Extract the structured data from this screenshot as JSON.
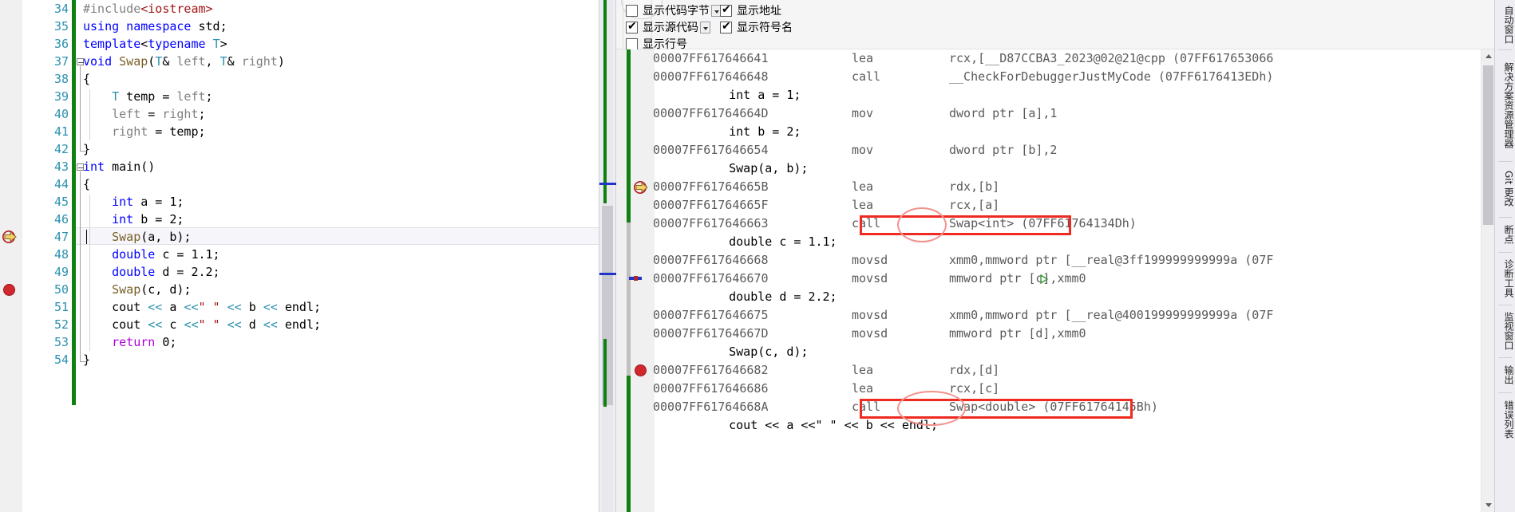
{
  "editor": {
    "first_line": 34,
    "lines": [
      {
        "n": 34,
        "tokens": [
          {
            "t": "#include",
            "c": "pp"
          },
          {
            "t": "<iostream>",
            "c": "str"
          }
        ]
      },
      {
        "n": 35,
        "tokens": [
          {
            "t": "using namespace ",
            "c": "k"
          },
          {
            "t": "std;",
            "c": "pl"
          }
        ]
      },
      {
        "n": 36,
        "tokens": [
          {
            "t": "template",
            "c": "k"
          },
          {
            "t": "<",
            "c": "pl"
          },
          {
            "t": "typename",
            "c": "k"
          },
          {
            "t": " ",
            "c": "pl"
          },
          {
            "t": "T",
            "c": "ty"
          },
          {
            "t": ">",
            "c": "pl"
          }
        ]
      },
      {
        "n": 37,
        "tokens": [
          {
            "t": "void",
            "c": "k"
          },
          {
            "t": " ",
            "c": "pl"
          },
          {
            "t": "Swap",
            "c": "fn"
          },
          {
            "t": "(",
            "c": "pl"
          },
          {
            "t": "T",
            "c": "ty"
          },
          {
            "t": "& ",
            "c": "pl"
          },
          {
            "t": "left",
            "c": "id"
          },
          {
            "t": ", ",
            "c": "pl"
          },
          {
            "t": "T",
            "c": "ty"
          },
          {
            "t": "& ",
            "c": "pl"
          },
          {
            "t": "right",
            "c": "id"
          },
          {
            "t": ")",
            "c": "pl"
          }
        ]
      },
      {
        "n": 38,
        "tokens": [
          {
            "t": "{",
            "c": "pl"
          }
        ]
      },
      {
        "n": 39,
        "tokens": [
          {
            "t": "    ",
            "c": "pl"
          },
          {
            "t": "T",
            "c": "ty"
          },
          {
            "t": " temp = ",
            "c": "pl"
          },
          {
            "t": "left",
            "c": "id"
          },
          {
            "t": ";",
            "c": "pl"
          }
        ]
      },
      {
        "n": 40,
        "tokens": [
          {
            "t": "    ",
            "c": "pl"
          },
          {
            "t": "left",
            "c": "id"
          },
          {
            "t": " = ",
            "c": "pl"
          },
          {
            "t": "right",
            "c": "id"
          },
          {
            "t": ";",
            "c": "pl"
          }
        ]
      },
      {
        "n": 41,
        "tokens": [
          {
            "t": "    ",
            "c": "pl"
          },
          {
            "t": "right",
            "c": "id"
          },
          {
            "t": " = ",
            "c": "pl"
          },
          {
            "t": "temp",
            "c": "pl"
          },
          {
            "t": ";",
            "c": "pl"
          }
        ]
      },
      {
        "n": 42,
        "tokens": [
          {
            "t": "}",
            "c": "pl"
          }
        ]
      },
      {
        "n": 43,
        "tokens": [
          {
            "t": "int",
            "c": "k"
          },
          {
            "t": " ",
            "c": "pl"
          },
          {
            "t": "main",
            "c": "pl"
          },
          {
            "t": "()",
            "c": "pl"
          }
        ]
      },
      {
        "n": 44,
        "tokens": [
          {
            "t": "{",
            "c": "pl"
          }
        ]
      },
      {
        "n": 45,
        "tokens": [
          {
            "t": "    ",
            "c": "pl"
          },
          {
            "t": "int",
            "c": "k"
          },
          {
            "t": " a = 1;",
            "c": "pl"
          }
        ]
      },
      {
        "n": 46,
        "tokens": [
          {
            "t": "    ",
            "c": "pl"
          },
          {
            "t": "int",
            "c": "k"
          },
          {
            "t": " b = 2;",
            "c": "pl"
          }
        ]
      },
      {
        "n": 47,
        "tokens": [
          {
            "t": "    ",
            "c": "pl"
          },
          {
            "t": "Swap",
            "c": "fn"
          },
          {
            "t": "(a, b);",
            "c": "pl"
          }
        ]
      },
      {
        "n": 48,
        "tokens": [
          {
            "t": "    ",
            "c": "pl"
          },
          {
            "t": "double",
            "c": "k"
          },
          {
            "t": " c = 1.1;",
            "c": "pl"
          }
        ]
      },
      {
        "n": 49,
        "tokens": [
          {
            "t": "    ",
            "c": "pl"
          },
          {
            "t": "double",
            "c": "k"
          },
          {
            "t": " d = 2.2;",
            "c": "pl"
          }
        ]
      },
      {
        "n": 50,
        "tokens": [
          {
            "t": "    ",
            "c": "pl"
          },
          {
            "t": "Swap",
            "c": "fn"
          },
          {
            "t": "(c, d);",
            "c": "pl"
          }
        ]
      },
      {
        "n": 51,
        "tokens": [
          {
            "t": "    cout ",
            "c": "pl"
          },
          {
            "t": "<<",
            "c": "ty"
          },
          {
            "t": " a ",
            "c": "pl"
          },
          {
            "t": "<<",
            "c": "ty"
          },
          {
            "t": "\" \"",
            "c": "str"
          },
          {
            "t": " ",
            "c": "pl"
          },
          {
            "t": "<<",
            "c": "ty"
          },
          {
            "t": " b ",
            "c": "pl"
          },
          {
            "t": "<<",
            "c": "ty"
          },
          {
            "t": " endl;",
            "c": "pl"
          }
        ]
      },
      {
        "n": 52,
        "tokens": [
          {
            "t": "    cout ",
            "c": "pl"
          },
          {
            "t": "<<",
            "c": "ty"
          },
          {
            "t": " c ",
            "c": "pl"
          },
          {
            "t": "<<",
            "c": "ty"
          },
          {
            "t": "\" \"",
            "c": "str"
          },
          {
            "t": " ",
            "c": "pl"
          },
          {
            "t": "<<",
            "c": "ty"
          },
          {
            "t": " d ",
            "c": "pl"
          },
          {
            "t": "<<",
            "c": "ty"
          },
          {
            "t": " endl;",
            "c": "pl"
          }
        ]
      },
      {
        "n": 53,
        "tokens": [
          {
            "t": "    ",
            "c": "pl"
          },
          {
            "t": "return",
            "c": "ctl"
          },
          {
            "t": " 0;",
            "c": "pl"
          }
        ]
      },
      {
        "n": 54,
        "tokens": [
          {
            "t": "}",
            "c": "pl"
          }
        ]
      }
    ],
    "current_line": 47,
    "breakpoint_lines": [
      50
    ],
    "execution_pointer_line": 47,
    "fold_lines": [
      37,
      43
    ]
  },
  "disassembly": {
    "options": [
      {
        "label": "显示代码字节",
        "checked": false,
        "has_dropdown": true
      },
      {
        "label": "显示地址",
        "checked": true,
        "has_dropdown": false
      },
      {
        "label": "显示源代码",
        "checked": true,
        "has_dropdown": true
      },
      {
        "label": "显示符号名",
        "checked": true,
        "has_dropdown": false
      },
      {
        "label": "显示行号",
        "checked": false,
        "has_dropdown": false
      }
    ],
    "rows": [
      {
        "kind": "asm",
        "addr": "00007FF617646641",
        "mn": "lea",
        "ops": "rcx,[__D87CCBA3_2023@02@21@cpp (07FF617653066",
        "marker": ""
      },
      {
        "kind": "asm",
        "addr": "00007FF617646648",
        "mn": "call",
        "ops": "__CheckForDebuggerJustMyCode (07FF6176413EDh)",
        "marker": ""
      },
      {
        "kind": "src",
        "src": "    int a = 1;"
      },
      {
        "kind": "asm",
        "addr": "00007FF61764664D",
        "mn": "mov",
        "ops": "dword ptr [a],1",
        "marker": ""
      },
      {
        "kind": "src",
        "src": "    int b = 2;"
      },
      {
        "kind": "asm",
        "addr": "00007FF617646654",
        "mn": "mov",
        "ops": "dword ptr [b],2",
        "marker": ""
      },
      {
        "kind": "src",
        "src": "    Swap(a, b);"
      },
      {
        "kind": "asm",
        "addr": "00007FF61764665B",
        "mn": "lea",
        "ops": "rdx,[b]",
        "marker": "current"
      },
      {
        "kind": "asm",
        "addr": "00007FF61764665F",
        "mn": "lea",
        "ops": "rcx,[a]",
        "marker": ""
      },
      {
        "kind": "asm",
        "addr": "00007FF617646663",
        "mn": "call",
        "ops": "Swap<int> (07FF61764134Dh)",
        "marker": "",
        "highlight": "int"
      },
      {
        "kind": "src",
        "src": "    double c = 1.1;"
      },
      {
        "kind": "asm",
        "addr": "00007FF617646668",
        "mn": "movsd",
        "ops": "xmm0,mmword ptr [__real@3ff199999999999a (07F",
        "marker": ""
      },
      {
        "kind": "asm",
        "addr": "00007FF617646670",
        "mn": "movsd",
        "ops": "mmword ptr [c],xmm0",
        "marker": "",
        "bookmark": true
      },
      {
        "kind": "src",
        "src": "    double d = 2.2;"
      },
      {
        "kind": "asm",
        "addr": "00007FF617646675",
        "mn": "movsd",
        "ops": "xmm0,mmword ptr [__real@400199999999999a (07F",
        "marker": ""
      },
      {
        "kind": "asm",
        "addr": "00007FF61764667D",
        "mn": "movsd",
        "ops": "mmword ptr [d],xmm0",
        "marker": ""
      },
      {
        "kind": "src",
        "src": "    Swap(c, d);"
      },
      {
        "kind": "asm",
        "addr": "00007FF617646682",
        "mn": "lea",
        "ops": "rdx,[d]",
        "marker": "breakpoint"
      },
      {
        "kind": "asm",
        "addr": "00007FF617646686",
        "mn": "lea",
        "ops": "rcx,[c]",
        "marker": ""
      },
      {
        "kind": "asm",
        "addr": "00007FF61764668A",
        "mn": "call",
        "ops": "Swap<double> (07FF61764145Bh)",
        "marker": "",
        "highlight": "double"
      },
      {
        "kind": "src",
        "src": "    cout << a <<\" \" << b << endl;"
      }
    ],
    "annotations": [
      {
        "name": "swap-int-highlight-box",
        "label": "Swap<int>"
      },
      {
        "name": "swap-double-highlight-box",
        "label": "Swap<double>"
      }
    ]
  },
  "right_rail": {
    "tabs": [
      "自动窗口",
      "解决方案资源管理器",
      "Git 更改",
      "断点",
      "诊断工具",
      "监视窗口",
      "输出",
      "错误列表"
    ]
  },
  "colors": {
    "annotation_red": "#ef2a21",
    "annotation_ellipse": "#f2928c",
    "change_bar_green": "#108010",
    "breakpoint_red": "#d1282e",
    "keyword_blue": "#0000ff",
    "type_teal": "#2b91af",
    "function_brown": "#795e26",
    "string_red": "#a31515",
    "return_purple": "#af00db",
    "line_number": "#2b91af",
    "disasm_gray": "#5a5a5a"
  }
}
